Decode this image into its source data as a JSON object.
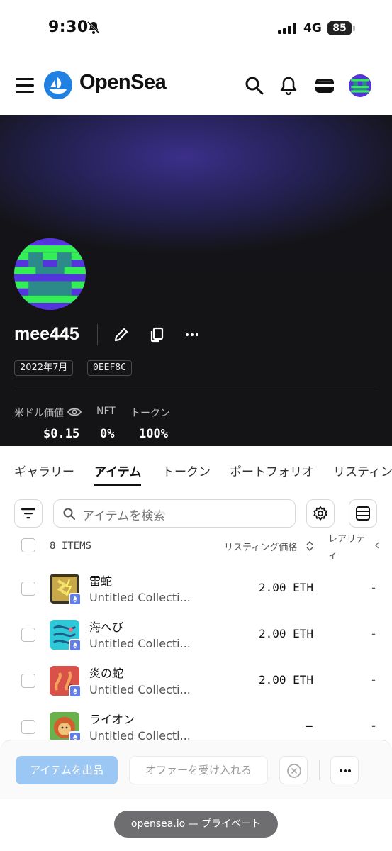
{
  "status_bar": {
    "time": "9:30",
    "network": "4G",
    "battery": "85"
  },
  "header": {
    "brand": "OpenSea",
    "brand_color": "#2081e2"
  },
  "profile": {
    "username": "mee445",
    "joined": "2022年7月",
    "address": "0EEF8C",
    "stats": [
      {
        "label": "米ドル価値",
        "value": "$0.15"
      },
      {
        "label": "NFT",
        "value": "0%"
      },
      {
        "label": "トークン",
        "value": "100%"
      }
    ]
  },
  "tabs": [
    "ギャラリー",
    "アイテム",
    "トークン",
    "ポートフォリオ",
    "リスティン"
  ],
  "active_tab": "アイテム",
  "search": {
    "placeholder": "アイテムを検索"
  },
  "table": {
    "count_label": "8 ITEMS",
    "col_price": "リスティング価格",
    "col_rarity_line1": "レアリテ",
    "col_rarity_line2": "ィ",
    "rows": [
      {
        "name": "雷蛇",
        "collection": "Untitled Collecti...",
        "price": "2.00 ETH",
        "rarity": "-"
      },
      {
        "name": "海へび",
        "collection": "Untitled Collecti...",
        "price": "2.00 ETH",
        "rarity": "-"
      },
      {
        "name": "炎の蛇",
        "collection": "Untitled Collecti...",
        "price": "2.00 ETH",
        "rarity": "-"
      },
      {
        "name": "ライオン",
        "collection": "Untitled Collecti...",
        "price": "–",
        "rarity": "-"
      }
    ]
  },
  "actions": {
    "list_items": "アイテムを出品",
    "accept_offers": "オファーを受け入れる"
  },
  "browser": {
    "url_label": "opensea.io — プライベート"
  }
}
